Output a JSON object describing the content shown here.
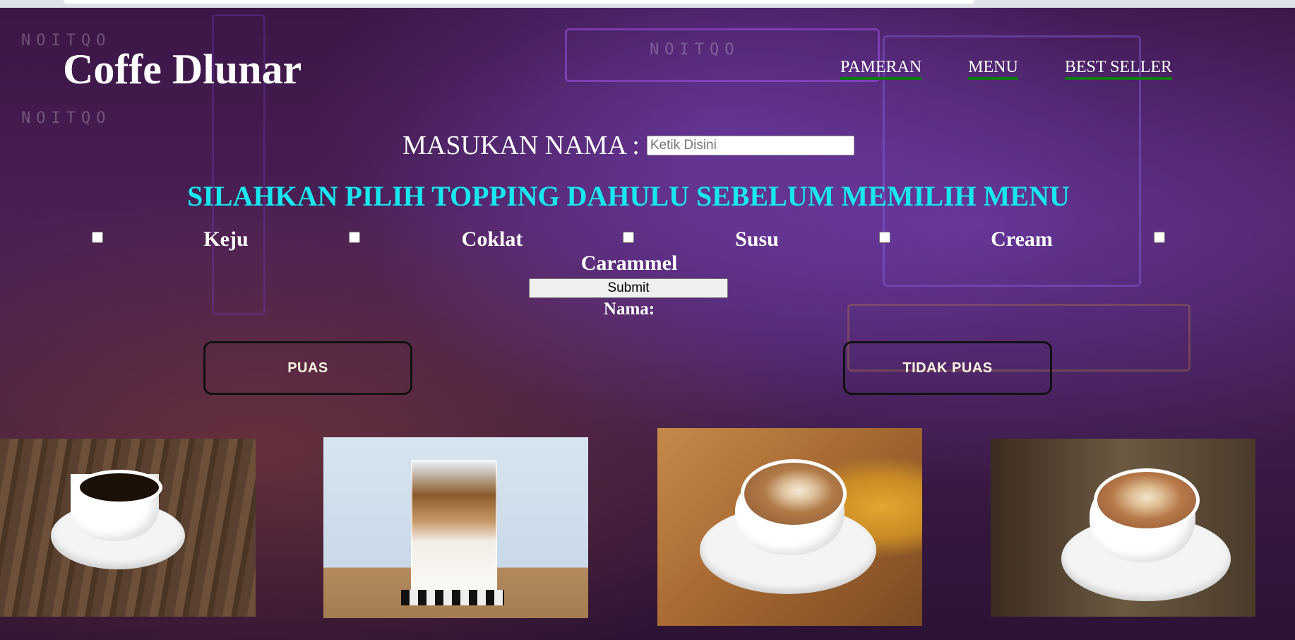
{
  "brand": {
    "logo": "Coffe Dlunar"
  },
  "nav": [
    {
      "label": "PAMERAN"
    },
    {
      "label": "MENU"
    },
    {
      "label": "BEST SELLER"
    }
  ],
  "form": {
    "name_label": "MASUKAN NAMA :",
    "name_placeholder": "Ketik Disini",
    "name_value": "",
    "topping_heading": "SILAHKAN PILIH TOPPING DAHULU SEBELUM MEMILIH MENU",
    "toppings": [
      {
        "label": "Keju",
        "checked": false
      },
      {
        "label": "Coklat",
        "checked": false
      },
      {
        "label": "Susu",
        "checked": false
      },
      {
        "label": "Cream",
        "checked": false
      },
      {
        "label": "Carammel",
        "checked": false
      }
    ],
    "submit_label": "Submit",
    "output_label": "Nama:"
  },
  "rating": {
    "satisfied_label": "PUAS",
    "unsatisfied_label": "TIDAK PUAS"
  },
  "colors": {
    "heading_accent": "#17e8f0",
    "nav_underline": "#0a7a12",
    "text": "#ffffff"
  }
}
